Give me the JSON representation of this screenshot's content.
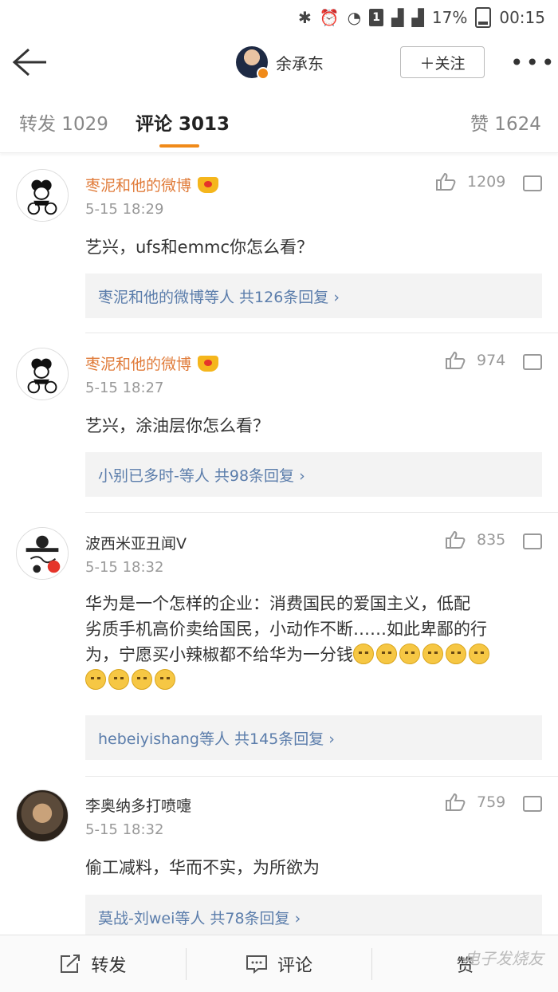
{
  "status_bar": {
    "battery": "17%",
    "time": "00:15",
    "sim_badge": "1"
  },
  "nav": {
    "back_icon": "back-arrow-icon",
    "user_name": "余承东",
    "follow_label": "＋关注",
    "more_icon": "more-dots-icon"
  },
  "tabs": [
    {
      "label": "转发 1029"
    },
    {
      "label": "评论 3013"
    },
    {
      "label": "赞 1624"
    }
  ],
  "comments": [
    {
      "name": "枣泥和他的微博",
      "time": "5-15 18:29",
      "likes": "1209",
      "text": "艺兴，ufs和emmc你怎么看？",
      "reply_users": "枣泥和他的微博等人",
      "reply_count": "共126条回复 ›"
    },
    {
      "name": "枣泥和他的微博",
      "time": "5-15 18:27",
      "likes": "974",
      "text": "艺兴，涂油层你怎么看？",
      "reply_users": "小别已多时-等人",
      "reply_count": "共98条回复 ›"
    },
    {
      "name": "波西米亚丑闻V",
      "time": "5-15 18:32",
      "likes": "835",
      "text_lines": [
        "华为是一个怎样的企业：消费国民的爱国主义，低配",
        "劣质手机高价卖给国民，小动作不断……如此卑鄙的行",
        "为，宁愿买小辣椒都不给华为一分钱"
      ],
      "reply_users": "hebeiyishang等人",
      "reply_count": "共145条回复 ›"
    },
    {
      "name": "李奥纳多打喷嚏",
      "time": "5-15 18:32",
      "likes": "759",
      "text": "偷工减料，华而不实，为所欲为",
      "reply_users": "莫战-刘wei等人",
      "reply_count": "共78条回复 ›"
    }
  ],
  "bottom_bar": {
    "repost": "转发",
    "comment": "评论",
    "like": "赞"
  },
  "watermark": "电子发烧友"
}
